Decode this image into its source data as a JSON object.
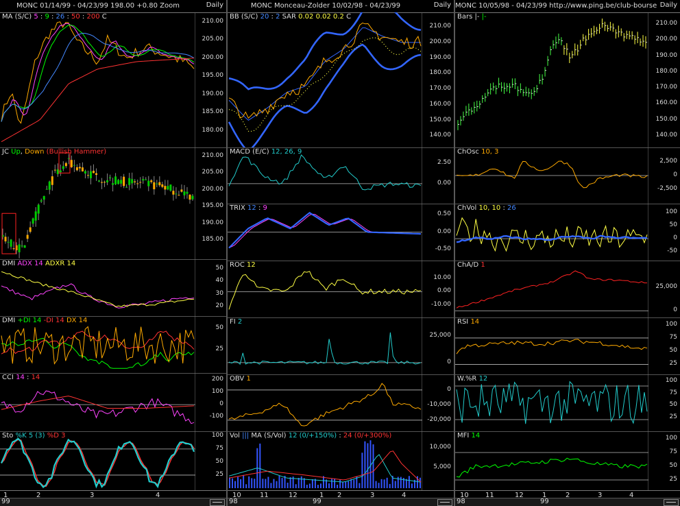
{
  "columns": [
    {
      "title": "MONC  01/14/99 - 04/23/99   198.00  +0.80  Zoom",
      "period": "Daily",
      "xticks": [
        "1",
        "2",
        "3",
        "4"
      ],
      "year": "99",
      "panels": [
        {
          "id": "ma",
          "label": [
            {
              "t": "MA (S/C) ",
              "c": "#dddddd"
            },
            {
              "t": "5",
              "c": "#ff44ff"
            },
            {
              "t": " : ",
              "c": "#dddddd"
            },
            {
              "t": "9",
              "c": "#00ff00"
            },
            {
              "t": " : ",
              "c": "#dddddd"
            },
            {
              "t": "26",
              "c": "#4488ff"
            },
            {
              "t": " : ",
              "c": "#dddddd"
            },
            {
              "t": "50",
              "c": "#ff3333"
            },
            {
              "t": " : ",
              "c": "#dddddd"
            },
            {
              "t": "200",
              "c": "#ff3333"
            },
            {
              "t": "   C",
              "c": "#dddddd"
            }
          ],
          "ticks": [
            "210.00",
            "205.00",
            "200.00",
            "195.00",
            "190.00",
            "185.00",
            "180.00"
          ],
          "kind": "ma"
        },
        {
          "id": "jc",
          "label": [
            {
              "t": "JC ",
              "c": "#dddddd"
            },
            {
              "t": "Up",
              "c": "#00ff00"
            },
            {
              "t": ", ",
              "c": "#dddddd"
            },
            {
              "t": "Down",
              "c": "#ffaa00"
            },
            {
              "t": " (Bullish Hammer)",
              "c": "#ff3333"
            }
          ],
          "ticks": [
            "210.00",
            "205.00",
            "200.00",
            "195.00",
            "190.00",
            "185.00"
          ],
          "kind": "candles"
        },
        {
          "id": "dmi1",
          "label": [
            {
              "t": "DMI ",
              "c": "#dddddd"
            },
            {
              "t": "ADX 14",
              "c": "#ff44ff"
            },
            {
              "t": " ",
              "c": "#dddddd"
            },
            {
              "t": "ADXR 14",
              "c": "#ffff44"
            }
          ],
          "ticks": [
            "50",
            "40",
            "30",
            "20"
          ],
          "kind": "adx"
        },
        {
          "id": "dmi2",
          "label": [
            {
              "t": "DMI ",
              "c": "#dddddd"
            },
            {
              "t": "+DI 14",
              "c": "#00ff00"
            },
            {
              "t": " ",
              "c": "#dddddd"
            },
            {
              "t": "-DI 14",
              "c": "#ff3333"
            },
            {
              "t": " ",
              "c": "#dddddd"
            },
            {
              "t": "DX 14",
              "c": "#ffaa00"
            }
          ],
          "ticks": [
            "50",
            "25"
          ],
          "kind": "di"
        },
        {
          "id": "cci",
          "label": [
            {
              "t": "CCI ",
              "c": "#dddddd"
            },
            {
              "t": "14",
              "c": "#ff44ff"
            },
            {
              "t": " : ",
              "c": "#dddddd"
            },
            {
              "t": "14",
              "c": "#ff3333"
            }
          ],
          "ticks": [
            "200",
            "100",
            "0",
            "-100"
          ],
          "kind": "cci"
        },
        {
          "id": "sto",
          "label": [
            {
              "t": "Sto ",
              "c": "#dddddd"
            },
            {
              "t": "%K 5 (3)",
              "c": "#22cccc"
            },
            {
              "t": " ",
              "c": "#dddddd"
            },
            {
              "t": "%D 3",
              "c": "#ff3333"
            }
          ],
          "ticks": [
            "100",
            "75",
            "50",
            "25"
          ],
          "kind": "sto"
        }
      ]
    },
    {
      "title": "MONC  Monceau-Zolder  10/02/98 - 04/23/99",
      "period": "Daily",
      "xticks": [
        "10",
        "11",
        "12",
        "1",
        "2",
        "3",
        "4"
      ],
      "year": "98",
      "year2": "99",
      "panels": [
        {
          "id": "bb",
          "label": [
            {
              "t": "BB (S/C) ",
              "c": "#dddddd"
            },
            {
              "t": "20",
              "c": "#4488ff"
            },
            {
              "t": " : ",
              "c": "#dddddd"
            },
            {
              "t": "2",
              "c": "#4488ff"
            },
            {
              "t": "   SAR  ",
              "c": "#dddddd"
            },
            {
              "t": "0.02  0.02  0.2",
              "c": "#ffff44"
            },
            {
              "t": "    C",
              "c": "#dddddd"
            }
          ],
          "ticks": [
            "210.00",
            "200.00",
            "190.00",
            "180.00",
            "170.00",
            "160.00",
            "150.00",
            "140.00"
          ],
          "kind": "bb"
        },
        {
          "id": "macd",
          "label": [
            {
              "t": "MACD (E/C) ",
              "c": "#dddddd"
            },
            {
              "t": "12, 26, 9",
              "c": "#22cccc"
            }
          ],
          "ticks": [
            "2.50",
            "0.00"
          ],
          "kind": "macd"
        },
        {
          "id": "trix",
          "label": [
            {
              "t": "TRIX ",
              "c": "#dddddd"
            },
            {
              "t": "12",
              "c": "#4488ff"
            },
            {
              "t": " : ",
              "c": "#dddddd"
            },
            {
              "t": "9",
              "c": "#ff44ff"
            }
          ],
          "ticks": [
            "0.50",
            "0.00",
            "-0.50"
          ],
          "kind": "trix"
        },
        {
          "id": "roc",
          "label": [
            {
              "t": "ROC ",
              "c": "#dddddd"
            },
            {
              "t": "12",
              "c": "#ffff44"
            }
          ],
          "ticks": [
            "10.00",
            "0.00",
            "-10.00"
          ],
          "kind": "roc"
        },
        {
          "id": "fi",
          "label": [
            {
              "t": "FI ",
              "c": "#dddddd"
            },
            {
              "t": "2",
              "c": "#22cccc"
            }
          ],
          "ticks": [
            "25,000",
            "0"
          ],
          "kind": "fi"
        },
        {
          "id": "obv",
          "label": [
            {
              "t": "OBV ",
              "c": "#dddddd"
            },
            {
              "t": "1",
              "c": "#ffaa00"
            }
          ],
          "ticks": [
            "0",
            "-10,000",
            "-20,000"
          ],
          "kind": "obv"
        },
        {
          "id": "vol",
          "label": [
            {
              "t": "Vol ",
              "c": "#dddddd"
            },
            {
              "t": "|||",
              "c": "#4488ff"
            },
            {
              "t": "  MA (S/Vol) ",
              "c": "#dddddd"
            },
            {
              "t": "12 (0/+150%)",
              "c": "#22cccc"
            },
            {
              "t": " : ",
              "c": "#dddddd"
            },
            {
              "t": "24 (0/+300%)",
              "c": "#ff3333"
            }
          ],
          "ticks": [
            "10,000",
            "5,000"
          ],
          "kind": "vol"
        }
      ]
    },
    {
      "title": "MONC  10/05/98 - 04/23/99   http://www.ping.be/club-bourse",
      "period": "Daily",
      "xticks": [
        "10",
        "11",
        "12",
        "1",
        "2",
        "3",
        "4"
      ],
      "year": "98",
      "year2": "99",
      "panels": [
        {
          "id": "bars",
          "label": [
            {
              "t": "Bars ",
              "c": "#dddddd"
            },
            {
              "t": "|-",
              "c": "#dddddd"
            },
            {
              "t": "  |-",
              "c": "#00ff00"
            }
          ],
          "ticks": [
            "210.00",
            "200.00",
            "190.00",
            "180.00",
            "170.00",
            "160.00",
            "150.00",
            "140.00"
          ],
          "kind": "bars"
        },
        {
          "id": "chosc",
          "label": [
            {
              "t": "ChOsc ",
              "c": "#dddddd"
            },
            {
              "t": "10, 3",
              "c": "#ffaa00"
            }
          ],
          "ticks": [
            "2,500",
            "0",
            "-2,500"
          ],
          "kind": "chosc"
        },
        {
          "id": "chvol",
          "label": [
            {
              "t": "ChVol ",
              "c": "#dddddd"
            },
            {
              "t": "10, 10",
              "c": "#ffff44"
            },
            {
              "t": " : ",
              "c": "#dddddd"
            },
            {
              "t": "26",
              "c": "#4488ff"
            }
          ],
          "ticks": [
            "100",
            "50",
            "0",
            "-50"
          ],
          "kind": "chvol"
        },
        {
          "id": "chad",
          "label": [
            {
              "t": "ChA/D ",
              "c": "#dddddd"
            },
            {
              "t": "1",
              "c": "#ff3333"
            }
          ],
          "ticks": [
            "25,000",
            "0"
          ],
          "kind": "chad"
        },
        {
          "id": "rsi",
          "label": [
            {
              "t": "RSI ",
              "c": "#dddddd"
            },
            {
              "t": "14",
              "c": "#ffaa00"
            }
          ],
          "ticks": [
            "100",
            "75",
            "50",
            "25"
          ],
          "kind": "rsi"
        },
        {
          "id": "wr",
          "label": [
            {
              "t": "W.%R ",
              "c": "#dddddd"
            },
            {
              "t": "12",
              "c": "#22cccc"
            }
          ],
          "ticks": [
            "100",
            "75",
            "50",
            "25"
          ],
          "kind": "wr"
        },
        {
          "id": "mfi",
          "label": [
            {
              "t": "MFI ",
              "c": "#dddddd"
            },
            {
              "t": "14",
              "c": "#00ff00"
            }
          ],
          "ticks": [
            "100",
            "75",
            "50",
            "25"
          ],
          "kind": "mfi"
        }
      ]
    }
  ]
}
